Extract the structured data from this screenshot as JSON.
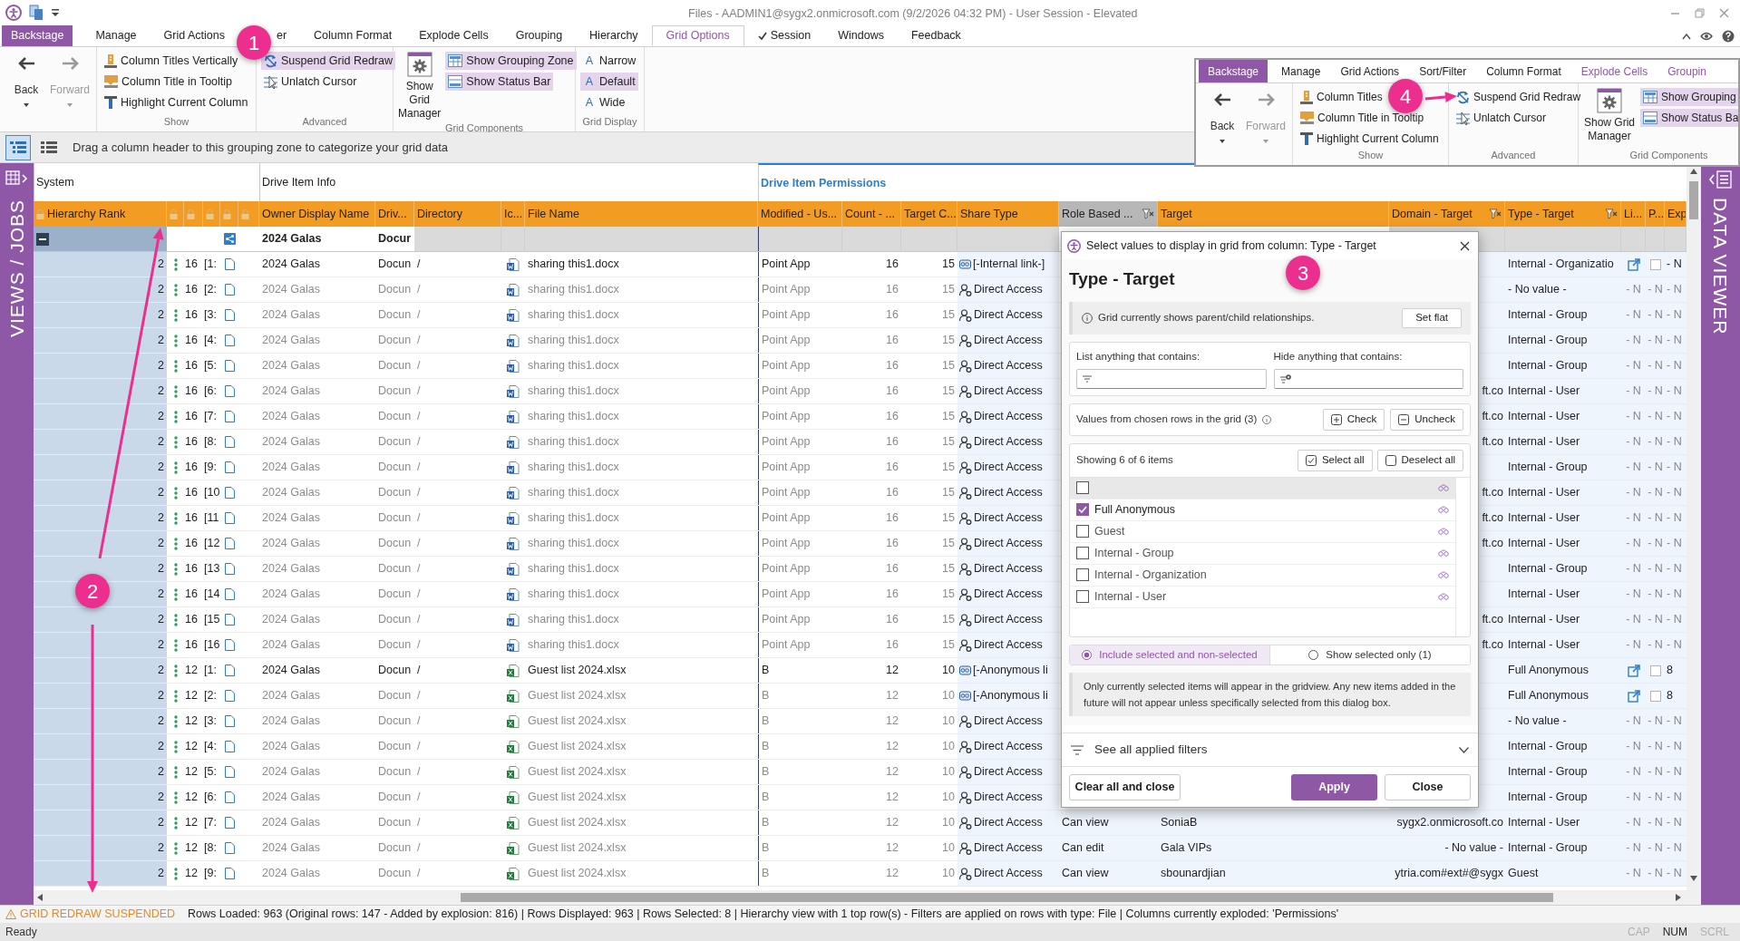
{
  "title_bar": {
    "title": "Files - AADMIN1@sygx2.onmicrosoft.com (9/2/2026 04:32 PM) - User Session - Elevated"
  },
  "ribbon_tabs": [
    {
      "label": "Backstage",
      "kind": "backstage",
      "selected": false
    },
    {
      "label": "Manage",
      "kind": "tab",
      "selected": false
    },
    {
      "label": "Grid Actions",
      "kind": "tab",
      "selected": false
    },
    {
      "label": "er",
      "kind": "partial",
      "selected": false
    },
    {
      "label": "Column Format",
      "kind": "tab",
      "selected": false
    },
    {
      "label": "Explode Cells",
      "kind": "tab",
      "selected": false
    },
    {
      "label": "Grouping",
      "kind": "tab",
      "selected": false
    },
    {
      "label": "Hierarchy",
      "kind": "tab",
      "selected": false
    },
    {
      "label": "Grid Options",
      "kind": "tab",
      "selected": true
    },
    {
      "label": "Session",
      "kind": "check_tab",
      "selected": false
    },
    {
      "label": "Windows",
      "kind": "tab",
      "selected": false
    },
    {
      "label": "Feedback",
      "kind": "tab",
      "selected": false
    }
  ],
  "ribbon": {
    "nav": [
      {
        "label": "Back",
        "disabled": false
      },
      {
        "label": "Forward",
        "disabled": true
      }
    ],
    "groups": [
      {
        "title": "Show",
        "kind": "list",
        "items": [
          {
            "label": "Column Titles Vertically",
            "on": false
          },
          {
            "label": "Column Title in Tooltip",
            "on": false
          },
          {
            "label": "Highlight Current Column",
            "on": false
          }
        ]
      },
      {
        "title": "Advanced",
        "kind": "list",
        "items": [
          {
            "label": "Suspend Grid Redraw",
            "on": true
          },
          {
            "label": "Unlatch Cursor",
            "on": false
          }
        ]
      },
      {
        "title": "Grid Components",
        "kind": "components",
        "big": {
          "label": "Show Grid Manager"
        },
        "items": [
          {
            "label": "Show Grouping Zone",
            "on": true
          },
          {
            "label": "Show Status Bar",
            "on": true
          }
        ]
      },
      {
        "title": "Grid Display",
        "kind": "list",
        "items": [
          {
            "label": "Narrow",
            "glyph": "A",
            "on": false
          },
          {
            "label": "Default",
            "glyph": "A",
            "on": true
          },
          {
            "label": "Wide",
            "glyph": "A",
            "on": false
          }
        ]
      }
    ]
  },
  "inset": {
    "tabs": [
      {
        "label": "Backstage",
        "kind": "backstage",
        "selected": false
      },
      {
        "label": "Manage",
        "kind": "tab",
        "selected": false
      },
      {
        "label": "Grid Actions",
        "kind": "tab",
        "selected": false
      },
      {
        "label": "Sort/Filter",
        "kind": "tab",
        "selected": false
      },
      {
        "label": "Column Format",
        "kind": "tab",
        "selected": false
      },
      {
        "label": "Explode Cells",
        "kind": "accent",
        "selected": false
      },
      {
        "label": "Groupin",
        "kind": "accent",
        "selected": false
      }
    ],
    "nav": [
      {
        "label": "Back",
        "disabled": false
      },
      {
        "label": "Forward",
        "disabled": true
      }
    ],
    "groups": [
      {
        "title": "Show",
        "kind": "list",
        "items": [
          {
            "label": "Column Titles",
            "on": false
          },
          {
            "label": "Column Title in Tooltip",
            "on": false
          },
          {
            "label": "Highlight Current Column",
            "on": false
          }
        ]
      },
      {
        "title": "Advanced",
        "kind": "list",
        "items": [
          {
            "label": "Suspend Grid Redraw",
            "on": false
          },
          {
            "label": "Unlatch Cursor",
            "on": false
          }
        ]
      },
      {
        "title": "Grid Components",
        "kind": "components",
        "big": {
          "label": "Show Grid Manager"
        },
        "items": [
          {
            "label": "Show Grouping",
            "on": true
          },
          {
            "label": "Show Status Ba",
            "on": true
          }
        ]
      }
    ]
  },
  "grouping_zone": {
    "views": [
      {
        "selected": true
      },
      {
        "selected": false
      }
    ],
    "hint": "Drag a column header to this grouping zone to categorize your grid data"
  },
  "side_panels": {
    "left": "VIEWS / JOBS",
    "right": "DATA VIEWER"
  },
  "grid": {
    "column_groups": [
      {
        "label": "System",
        "highlighted": false
      },
      {
        "label": "Drive Item Info",
        "highlighted": false
      },
      {
        "label": "Drive Item Permissions",
        "highlighted": true
      }
    ],
    "columns": [
      {
        "label": "Hierarchy Rank",
        "kind": "locked"
      },
      {
        "kind": "lock"
      },
      {
        "kind": "lock"
      },
      {
        "kind": "lock"
      },
      {
        "kind": "lock"
      },
      {
        "kind": "lock"
      },
      {
        "label": "Owner Display Name",
        "kind": "text"
      },
      {
        "label": "Driv...",
        "kind": "text"
      },
      {
        "label": "Directory",
        "kind": "text"
      },
      {
        "label": "Ic...",
        "kind": "text"
      },
      {
        "label": "File Name",
        "kind": "text"
      },
      {
        "label": "Modified - Us...",
        "kind": "text"
      },
      {
        "label": "Count - ...",
        "kind": "text"
      },
      {
        "label": "Target C...",
        "kind": "text"
      },
      {
        "label": "Share Type",
        "kind": "text"
      },
      {
        "label": "Role Based ...",
        "kind": "filtered_active"
      },
      {
        "label": "Target",
        "kind": "text"
      },
      {
        "label": "Domain - Target",
        "kind": "filtered"
      },
      {
        "label": "Type - Target",
        "kind": "filtered"
      },
      {
        "label": "Li...",
        "kind": "text"
      },
      {
        "label": "P...",
        "kind": "text"
      },
      {
        "label": "Exp",
        "kind": "text"
      }
    ],
    "group_row": {
      "owner": "2024 Galas",
      "drive": "Docur",
      "expanded": true
    },
    "rows": [
      {
        "rank": "2",
        "size": "16",
        "index": "[1:",
        "owner": "2024 Galas",
        "drive": "Docun",
        "directory": "/",
        "file": {
          "kind": "document",
          "name": "sharing this1.docx"
        },
        "modified": "Point App",
        "count": "16",
        "target_count": "15",
        "share": {
          "kind": "link",
          "type": "[-Internal link-]"
        },
        "type_target": "Internal - Organizatio",
        "link": true,
        "p_checked": false,
        "exp": "- N",
        "muted": false
      },
      {
        "rank": "2",
        "size": "16",
        "index": "[2:",
        "owner": "2024 Galas",
        "drive": "Docun",
        "directory": "/",
        "file": {
          "kind": "document",
          "name": "sharing this1.docx"
        },
        "modified": "Point App",
        "count": "16",
        "target_count": "15",
        "share": {
          "kind": "direct",
          "type": "Direct Access"
        },
        "type_target": "- No value -",
        "link": false,
        "li": "- N",
        "p": "- N",
        "exp": "- N",
        "muted": true
      },
      {
        "rank": "2",
        "size": "16",
        "index": "[3:",
        "owner": "2024 Galas",
        "drive": "Docun",
        "directory": "/",
        "file": {
          "kind": "document",
          "name": "sharing this1.docx"
        },
        "modified": "Point App",
        "count": "16",
        "target_count": "15",
        "share": {
          "kind": "direct",
          "type": "Direct Access"
        },
        "type_target": "Internal - Group",
        "link": false,
        "li": "- N",
        "p": "- N",
        "exp": "- N",
        "muted": true
      },
      {
        "rank": "2",
        "size": "16",
        "index": "[4:",
        "owner": "2024 Galas",
        "drive": "Docun",
        "directory": "/",
        "file": {
          "kind": "document",
          "name": "sharing this1.docx"
        },
        "modified": "Point App",
        "count": "16",
        "target_count": "15",
        "share": {
          "kind": "direct",
          "type": "Direct Access"
        },
        "type_target": "Internal - Group",
        "link": false,
        "li": "- N",
        "p": "- N",
        "exp": "- N",
        "muted": true
      },
      {
        "rank": "2",
        "size": "16",
        "index": "[5:",
        "owner": "2024 Galas",
        "drive": "Docun",
        "directory": "/",
        "file": {
          "kind": "document",
          "name": "sharing this1.docx"
        },
        "modified": "Point App",
        "count": "16",
        "target_count": "15",
        "share": {
          "kind": "direct",
          "type": "Direct Access"
        },
        "type_target": "Internal - Group",
        "link": false,
        "li": "- N",
        "p": "- N",
        "exp": "- N",
        "muted": true
      },
      {
        "rank": "2",
        "size": "16",
        "index": "[6:",
        "owner": "2024 Galas",
        "drive": "Docun",
        "directory": "/",
        "file": {
          "kind": "document",
          "name": "sharing this1.docx"
        },
        "modified": "Point App",
        "count": "16",
        "target_count": "15",
        "share": {
          "kind": "direct",
          "type": "Direct Access"
        },
        "domain": "ft.co",
        "type_target": "Internal - User",
        "link": false,
        "li": "- N",
        "p": "- N",
        "exp": "- N",
        "muted": true
      },
      {
        "rank": "2",
        "size": "16",
        "index": "[7:",
        "owner": "2024 Galas",
        "drive": "Docun",
        "directory": "/",
        "file": {
          "kind": "document",
          "name": "sharing this1.docx"
        },
        "modified": "Point App",
        "count": "16",
        "target_count": "15",
        "share": {
          "kind": "direct",
          "type": "Direct Access"
        },
        "domain": "ft.co",
        "type_target": "Internal - User",
        "link": false,
        "li": "- N",
        "p": "- N",
        "exp": "- N",
        "muted": true
      },
      {
        "rank": "2",
        "size": "16",
        "index": "[8:",
        "owner": "2024 Galas",
        "drive": "Docun",
        "directory": "/",
        "file": {
          "kind": "document",
          "name": "sharing this1.docx"
        },
        "modified": "Point App",
        "count": "16",
        "target_count": "15",
        "share": {
          "kind": "direct",
          "type": "Direct Access"
        },
        "domain": "ft.co",
        "type_target": "Internal - User",
        "link": false,
        "li": "- N",
        "p": "- N",
        "exp": "- N",
        "muted": true
      },
      {
        "rank": "2",
        "size": "16",
        "index": "[9:",
        "owner": "2024 Galas",
        "drive": "Docun",
        "directory": "/",
        "file": {
          "kind": "document",
          "name": "sharing this1.docx"
        },
        "modified": "Point App",
        "count": "16",
        "target_count": "15",
        "share": {
          "kind": "direct",
          "type": "Direct Access"
        },
        "type_target": "Internal - Group",
        "link": false,
        "li": "- N",
        "p": "- N",
        "exp": "- N",
        "muted": true
      },
      {
        "rank": "2",
        "size": "16",
        "index": "[10",
        "owner": "2024 Galas",
        "drive": "Docun",
        "directory": "/",
        "file": {
          "kind": "document",
          "name": "sharing this1.docx"
        },
        "modified": "Point App",
        "count": "16",
        "target_count": "15",
        "share": {
          "kind": "direct",
          "type": "Direct Access"
        },
        "domain": "ft.co",
        "type_target": "Internal - User",
        "link": false,
        "li": "- N",
        "p": "- N",
        "exp": "- N",
        "muted": true
      },
      {
        "rank": "2",
        "size": "16",
        "index": "[11",
        "owner": "2024 Galas",
        "drive": "Docun",
        "directory": "/",
        "file": {
          "kind": "document",
          "name": "sharing this1.docx"
        },
        "modified": "Point App",
        "count": "16",
        "target_count": "15",
        "share": {
          "kind": "direct",
          "type": "Direct Access"
        },
        "domain": "ft.co",
        "type_target": "Internal - User",
        "link": false,
        "li": "- N",
        "p": "- N",
        "exp": "- N",
        "muted": true
      },
      {
        "rank": "2",
        "size": "16",
        "index": "[12",
        "owner": "2024 Galas",
        "drive": "Docun",
        "directory": "/",
        "file": {
          "kind": "document",
          "name": "sharing this1.docx"
        },
        "modified": "Point App",
        "count": "16",
        "target_count": "15",
        "share": {
          "kind": "direct",
          "type": "Direct Access"
        },
        "domain": "ft.co",
        "type_target": "Internal - User",
        "link": false,
        "li": "- N",
        "p": "- N",
        "exp": "- N",
        "muted": true
      },
      {
        "rank": "2",
        "size": "16",
        "index": "[13",
        "owner": "2024 Galas",
        "drive": "Docun",
        "directory": "/",
        "file": {
          "kind": "document",
          "name": "sharing this1.docx"
        },
        "modified": "Point App",
        "count": "16",
        "target_count": "15",
        "share": {
          "kind": "direct",
          "type": "Direct Access"
        },
        "type_target": "Internal - Group",
        "link": false,
        "li": "- N",
        "p": "- N",
        "exp": "- N",
        "muted": true
      },
      {
        "rank": "2",
        "size": "16",
        "index": "[14",
        "owner": "2024 Galas",
        "drive": "Docun",
        "directory": "/",
        "file": {
          "kind": "document",
          "name": "sharing this1.docx"
        },
        "modified": "Point App",
        "count": "16",
        "target_count": "15",
        "share": {
          "kind": "direct",
          "type": "Direct Access"
        },
        "type_target": "Internal - User",
        "link": false,
        "li": "- N",
        "p": "- N",
        "exp": "- N",
        "muted": true
      },
      {
        "rank": "2",
        "size": "16",
        "index": "[15",
        "owner": "2024 Galas",
        "drive": "Docun",
        "directory": "/",
        "file": {
          "kind": "document",
          "name": "sharing this1.docx"
        },
        "modified": "Point App",
        "count": "16",
        "target_count": "15",
        "share": {
          "kind": "direct",
          "type": "Direct Access"
        },
        "domain": "ft.co",
        "type_target": "Internal - User",
        "link": false,
        "li": "- N",
        "p": "- N",
        "exp": "- N",
        "muted": true
      },
      {
        "rank": "2",
        "size": "16",
        "index": "[16",
        "owner": "2024 Galas",
        "drive": "Docun",
        "directory": "/",
        "file": {
          "kind": "document",
          "name": "sharing this1.docx"
        },
        "modified": "Point App",
        "count": "16",
        "target_count": "15",
        "share": {
          "kind": "direct",
          "type": "Direct Access"
        },
        "domain": "ft.co",
        "type_target": "Internal - User",
        "link": false,
        "li": "- N",
        "p": "- N",
        "exp": "- N",
        "muted": true
      },
      {
        "rank": "2",
        "size": "12",
        "index": "[1:",
        "owner": "2024 Galas",
        "drive": "Docun",
        "directory": "/",
        "file": {
          "kind": "spreadsheet",
          "name": "Guest list 2024.xlsx"
        },
        "modified": "B",
        "count": "12",
        "target_count": "10",
        "share": {
          "kind": "link",
          "type": "[-Anonymous li"
        },
        "type_target": "Full Anonymous",
        "link": true,
        "p_checked": false,
        "exp": "8",
        "muted": false
      },
      {
        "rank": "2",
        "size": "12",
        "index": "[2:",
        "owner": "2024 Galas",
        "drive": "Docun",
        "directory": "/",
        "file": {
          "kind": "spreadsheet",
          "name": "Guest list 2024.xlsx"
        },
        "modified": "B",
        "count": "12",
        "target_count": "10",
        "share": {
          "kind": "link",
          "type": "[-Anonymous li"
        },
        "type_target": "Full Anonymous",
        "link": true,
        "p_checked": false,
        "exp": "8",
        "muted": true
      },
      {
        "rank": "2",
        "size": "12",
        "index": "[3:",
        "owner": "2024 Galas",
        "drive": "Docun",
        "directory": "/",
        "file": {
          "kind": "spreadsheet",
          "name": "Guest list 2024.xlsx"
        },
        "modified": "B",
        "count": "12",
        "target_count": "10",
        "share": {
          "kind": "direct",
          "type": "Direct Access"
        },
        "type_target": "- No value -",
        "link": false,
        "li": "- N",
        "p": "- N",
        "exp": "- N",
        "muted": true
      },
      {
        "rank": "2",
        "size": "12",
        "index": "[4:",
        "owner": "2024 Galas",
        "drive": "Docun",
        "directory": "/",
        "file": {
          "kind": "spreadsheet",
          "name": "Guest list 2024.xlsx"
        },
        "modified": "B",
        "count": "12",
        "target_count": "10",
        "share": {
          "kind": "direct",
          "type": "Direct Access"
        },
        "type_target": "Internal - Group",
        "link": false,
        "li": "- N",
        "p": "- N",
        "exp": "- N",
        "muted": true
      },
      {
        "rank": "2",
        "size": "12",
        "index": "[5:",
        "owner": "2024 Galas",
        "drive": "Docun",
        "directory": "/",
        "file": {
          "kind": "spreadsheet",
          "name": "Guest list 2024.xlsx"
        },
        "modified": "B",
        "count": "12",
        "target_count": "10",
        "share": {
          "kind": "direct",
          "type": "Direct Access"
        },
        "type_target": "Internal - Group",
        "link": false,
        "li": "- N",
        "p": "- N",
        "exp": "- N",
        "muted": true
      },
      {
        "rank": "2",
        "size": "12",
        "index": "[6:",
        "owner": "2024 Galas",
        "drive": "Docun",
        "directory": "/",
        "file": {
          "kind": "spreadsheet",
          "name": "Guest list 2024.xlsx"
        },
        "modified": "B",
        "count": "12",
        "target_count": "10",
        "share": {
          "kind": "direct",
          "type": "Direct Access"
        },
        "type_target": "Internal - Group",
        "link": false,
        "li": "- N",
        "p": "- N",
        "exp": "- N",
        "muted": true
      },
      {
        "rank": "2",
        "size": "12",
        "index": "[7:",
        "owner": "2024 Galas",
        "drive": "Docun",
        "directory": "/",
        "file": {
          "kind": "spreadsheet",
          "name": "Guest list 2024.xlsx"
        },
        "modified": "B",
        "count": "12",
        "target_count": "10",
        "share": {
          "kind": "direct",
          "type": "Direct Access"
        },
        "role": "Can view",
        "target": "SoniaB",
        "domain": "sygx2.onmicrosoft.co",
        "type_target": "Internal - User",
        "link": false,
        "li": "- N",
        "p": "- N",
        "exp": "- N",
        "muted": true
      },
      {
        "rank": "2",
        "size": "12",
        "index": "[8:",
        "owner": "2024 Galas",
        "drive": "Docun",
        "directory": "/",
        "file": {
          "kind": "spreadsheet",
          "name": "Guest list 2024.xlsx"
        },
        "modified": "B",
        "count": "12",
        "target_count": "10",
        "share": {
          "kind": "direct",
          "type": "Direct Access"
        },
        "role": "Can edit",
        "target": "Gala VIPs",
        "domain": "- No value -",
        "type_target": "Internal - Group",
        "link": false,
        "li": "- N",
        "p": "- N",
        "exp": "- N",
        "muted": true
      },
      {
        "rank": "2",
        "size": "12",
        "index": "[9:",
        "owner": "2024 Galas",
        "drive": "Docun",
        "directory": "/",
        "file": {
          "kind": "spreadsheet",
          "name": "Guest list 2024.xlsx"
        },
        "modified": "B",
        "count": "12",
        "target_count": "10",
        "share": {
          "kind": "direct",
          "type": "Direct Access"
        },
        "role": "Can view",
        "target": "sbounardjian",
        "domain": "ytria.com#ext#@sygx",
        "type_target": "Guest",
        "link": false,
        "li": "- N",
        "p": "- N",
        "exp": "- N",
        "muted": true
      }
    ]
  },
  "filter_dialog": {
    "title": "Select values to display in grid from column: Type - Target",
    "heading": "Type - Target",
    "info": "Grid currently shows parent/child relationships.",
    "set_flat": "Set flat",
    "list_label": "List anything that contains:",
    "hide_label": "Hide anything that contains:",
    "values_label": "Values from chosen rows in the grid (3)",
    "check": "Check",
    "uncheck": "Uncheck",
    "showing": "Showing 6 of 6 items",
    "select_all": "Select all",
    "deselect_all": "Deselect all",
    "items": [
      {
        "checked": false,
        "highlighted": true
      },
      {
        "label": "Full Anonymous",
        "checked": true,
        "highlighted": false
      },
      {
        "label": "Guest",
        "checked": false,
        "highlighted": false
      },
      {
        "label": "Internal - Group",
        "checked": false,
        "highlighted": false
      },
      {
        "label": "Internal - Organization",
        "checked": false,
        "highlighted": false
      },
      {
        "label": "Internal - User",
        "checked": false,
        "highlighted": false
      }
    ],
    "modes": [
      {
        "label": "Include selected and non-selected",
        "selected": true
      },
      {
        "label": "Show selected only (1)",
        "selected": false
      }
    ],
    "note": "Only currently selected items will appear in the gridview. Any new items added in the future will not appear unless specifically selected from this dialog box.",
    "applied_filters": "See all applied filters",
    "buttons": [
      {
        "label": "Clear all and close",
        "kind": "secondary"
      },
      {
        "label": "Apply",
        "kind": "primary"
      },
      {
        "label": "Close",
        "kind": "secondary"
      }
    ]
  },
  "status_bar": {
    "warning": "GRID REDRAW SUSPENDED",
    "summary": "Rows Loaded: 963 (Original rows: 147 - Added by explosion: 816) | Rows Displayed: 963 | Rows Selected: 8 | Hierarchy view with 1 top row(s) - Filters are applied on rows with type: File | Columns currently exploded: 'Permissions'"
  },
  "ready_bar": {
    "text": "Ready",
    "indicators": [
      {
        "label": "CAP",
        "on": false
      },
      {
        "label": "NUM",
        "on": true
      },
      {
        "label": "SCRL",
        "on": false
      }
    ]
  },
  "annotations": [
    {
      "label": "1"
    },
    {
      "label": "2"
    },
    {
      "label": "3"
    },
    {
      "label": "4"
    }
  ]
}
